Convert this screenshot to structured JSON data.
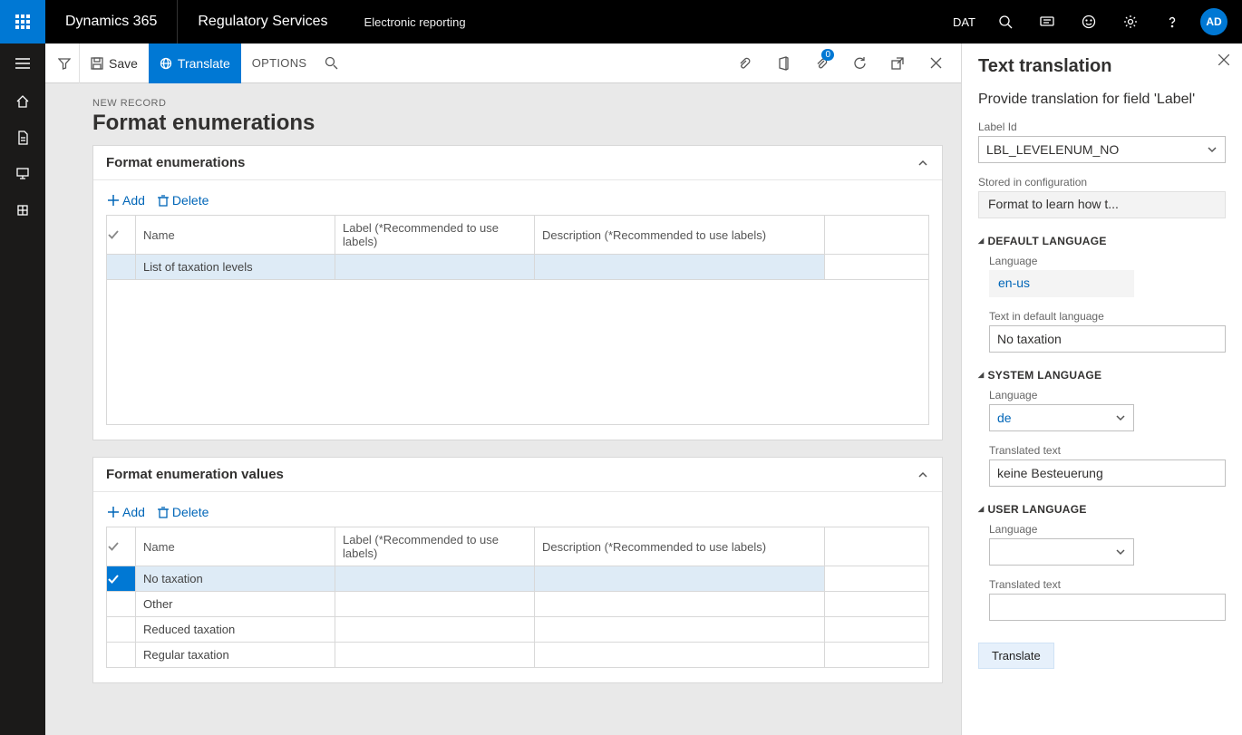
{
  "topbar": {
    "brand": "Dynamics 365",
    "module": "Regulatory Services",
    "breadcrumb": "Electronic reporting",
    "company": "DAT",
    "avatar": "AD"
  },
  "actionbar": {
    "save": "Save",
    "translate": "Translate",
    "options": "OPTIONS",
    "badge": "0"
  },
  "page": {
    "eyebrow": "NEW RECORD",
    "title": "Format enumerations"
  },
  "section1": {
    "title": "Format enumerations",
    "add": "Add",
    "delete": "Delete",
    "columns": [
      "Name",
      "Label (*Recommended to use labels)",
      "Description (*Recommended to use labels)"
    ],
    "rows": [
      {
        "selected": true,
        "checked": false,
        "name": "List of taxation levels",
        "label": "",
        "desc": ""
      }
    ]
  },
  "section2": {
    "title": "Format enumeration values",
    "add": "Add",
    "delete": "Delete",
    "columns": [
      "Name",
      "Label (*Recommended to use labels)",
      "Description (*Recommended to use labels)"
    ],
    "rows": [
      {
        "selected": true,
        "checked": true,
        "name": "No taxation",
        "label": "",
        "desc": ""
      },
      {
        "selected": false,
        "checked": false,
        "name": "Other",
        "label": "",
        "desc": ""
      },
      {
        "selected": false,
        "checked": false,
        "name": "Reduced taxation",
        "label": "",
        "desc": ""
      },
      {
        "selected": false,
        "checked": false,
        "name": "Regular taxation",
        "label": "",
        "desc": ""
      }
    ]
  },
  "panel": {
    "title": "Text translation",
    "subtitle": "Provide translation for field 'Label'",
    "label_id_label": "Label Id",
    "label_id": "LBL_LEVELENUM_NO",
    "stored_label": "Stored in configuration",
    "stored_value": "Format to learn how t...",
    "default_lang_section": "DEFAULT LANGUAGE",
    "default_lang_label": "Language",
    "default_lang_value": "en-us",
    "default_text_label": "Text in default language",
    "default_text_value": "No taxation",
    "system_lang_section": "SYSTEM LANGUAGE",
    "system_lang_label": "Language",
    "system_lang_value": "de",
    "system_text_label": "Translated text",
    "system_text_value": "keine Besteuerung",
    "user_lang_section": "USER LANGUAGE",
    "user_lang_label": "Language",
    "user_lang_value": "",
    "user_text_label": "Translated text",
    "user_text_value": "",
    "translate_btn": "Translate"
  }
}
